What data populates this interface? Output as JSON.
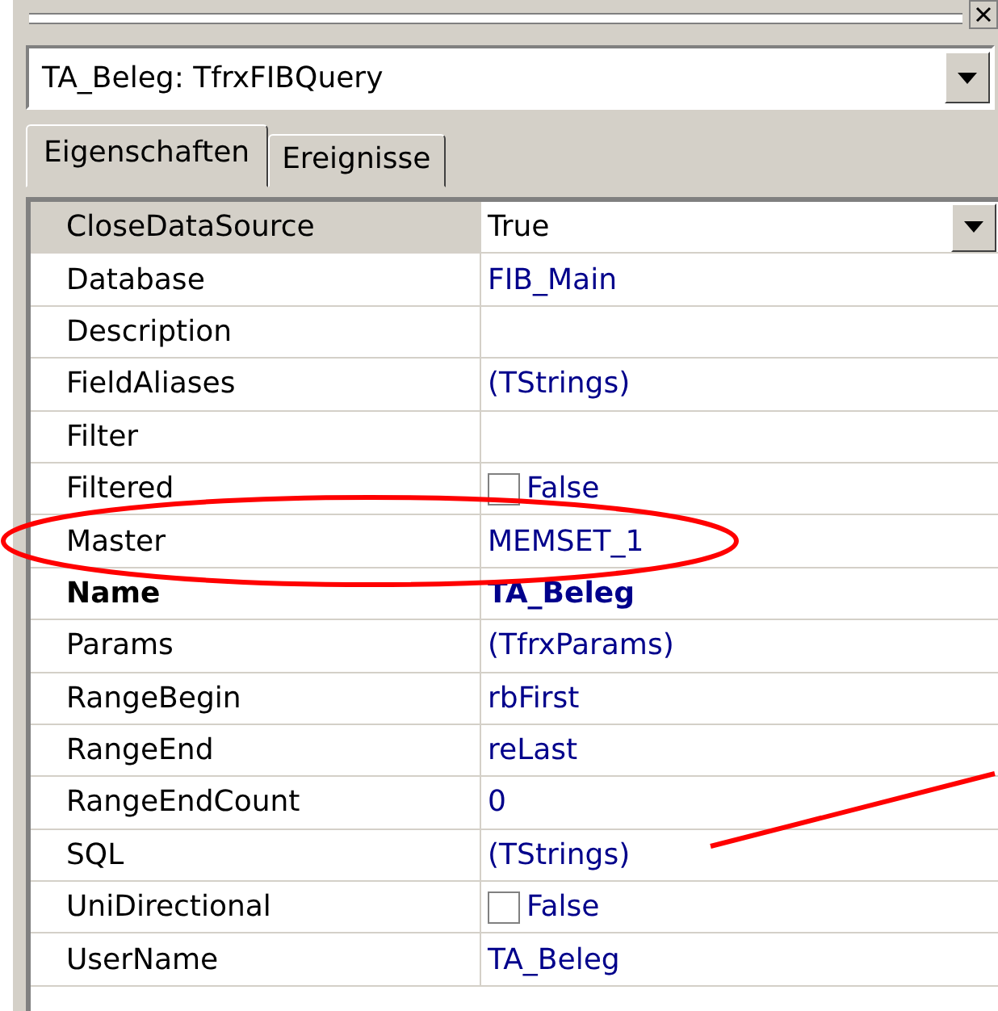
{
  "object_selector": {
    "value": "TA_Beleg: TfrxFIBQuery"
  },
  "tabs": [
    {
      "label": "Eigenschaften",
      "selected": true
    },
    {
      "label": "Ereignisse",
      "selected": false
    }
  ],
  "properties": [
    {
      "name": "CloseDataSource",
      "value": "True",
      "kind": "text",
      "selected": true,
      "bold": false
    },
    {
      "name": "Database",
      "value": "FIB_Main",
      "kind": "text",
      "selected": false,
      "bold": false
    },
    {
      "name": "Description",
      "kind": "text",
      "selected": false,
      "bold": false
    },
    {
      "name": "FieldAliases",
      "value": "(TStrings)",
      "kind": "text",
      "selected": false,
      "bold": false
    },
    {
      "name": "Filter",
      "kind": "text",
      "selected": false,
      "bold": false
    },
    {
      "name": "Filtered",
      "value": "False",
      "kind": "checkbox",
      "checked": false,
      "selected": false,
      "bold": false
    },
    {
      "name": "Master",
      "value": "MEMSET_1",
      "kind": "text",
      "selected": false,
      "bold": false
    },
    {
      "name": "Name",
      "value": "TA_Beleg",
      "kind": "text",
      "selected": false,
      "bold": true
    },
    {
      "name": "Params",
      "value": "(TfrxParams)",
      "kind": "text",
      "selected": false,
      "bold": false
    },
    {
      "name": "RangeBegin",
      "value": "rbFirst",
      "kind": "text",
      "selected": false,
      "bold": false
    },
    {
      "name": "RangeEnd",
      "value": "reLast",
      "kind": "text",
      "selected": false,
      "bold": false
    },
    {
      "name": "RangeEndCount",
      "value": "0",
      "kind": "text",
      "selected": false,
      "bold": false
    },
    {
      "name": "SQL",
      "value": "(TStrings)",
      "kind": "text",
      "selected": false,
      "bold": false
    },
    {
      "name": "UniDirectional",
      "value": "False",
      "kind": "checkbox",
      "checked": false,
      "selected": false,
      "bold": false
    },
    {
      "name": "UserName",
      "value": "TA_Beleg",
      "kind": "text",
      "selected": false,
      "bold": false
    }
  ]
}
